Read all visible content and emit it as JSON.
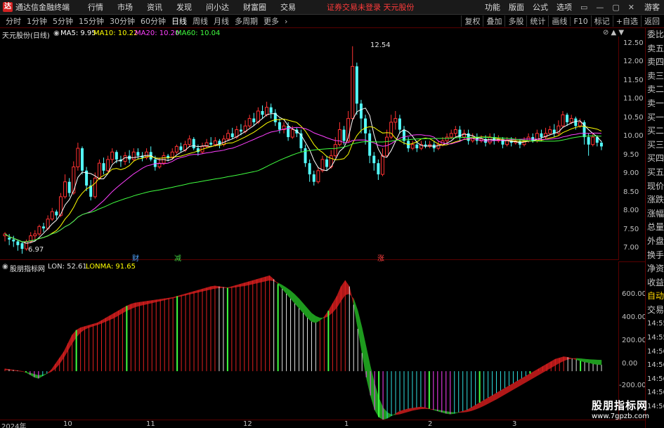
{
  "menubar": {
    "app_name": "通达信金融终端",
    "menus": [
      "行情",
      "市场",
      "资讯",
      "发现",
      "问小达",
      "财富圈",
      "交易"
    ],
    "status": "证券交易未登录  天元股份",
    "right_menus": [
      "功能",
      "版面",
      "公式",
      "选项"
    ],
    "window_controls": [
      "▭",
      "—",
      "▢",
      "✕"
    ],
    "guest": "游客"
  },
  "periodbar": {
    "periods": [
      "分时",
      "1分钟",
      "5分钟",
      "15分钟",
      "30分钟",
      "60分钟",
      "日线",
      "周线",
      "月线",
      "多周期",
      "更多"
    ],
    "active": "日线",
    "tools": [
      "复权",
      "叠加",
      "多股",
      "统计",
      "画线",
      "F10",
      "标记",
      "+自选",
      "返回"
    ]
  },
  "main_chart": {
    "title": "天元股份(日线)",
    "ma": [
      {
        "label": "MA5: 9.95",
        "color": "#ffffff"
      },
      {
        "label": "MA10: 10.22",
        "color": "#ffff00"
      },
      {
        "label": "MA20: 10.20",
        "color": "#ff40ff"
      },
      {
        "label": "MA60: 10.04",
        "color": "#40ff40"
      }
    ],
    "high_label": "12.54",
    "low_label": "6.97",
    "price_axis": [
      "12.50",
      "12.00",
      "11.50",
      "11.00",
      "10.50",
      "10.00",
      "9.50",
      "9.00",
      "8.50",
      "8.00",
      "7.50",
      "7.00"
    ],
    "markers": [
      {
        "text": "财",
        "color": "#4fa3ff"
      },
      {
        "text": "减",
        "color": "#40d040"
      },
      {
        "text": "涨",
        "color": "#ff4040"
      }
    ]
  },
  "indicator": {
    "title": "股朋指标网",
    "lon": "LON: 52.61",
    "lonma": "LONMA: 91.65",
    "axis": [
      "600.00",
      "400.00",
      "200.00",
      "0.00",
      "-200.00"
    ]
  },
  "date_axis": [
    "2024年",
    "10",
    "11",
    "12",
    "1",
    "2",
    "3"
  ],
  "right_panel": {
    "items": [
      "委比",
      "卖五",
      "卖四",
      "卖三",
      "卖二",
      "卖一",
      "买一",
      "买二",
      "买三",
      "买四",
      "买五",
      "现价",
      "涨跌",
      "涨幅",
      "总量",
      "外盘",
      "换手",
      "净资",
      "收益",
      "自动",
      "交易",
      "14:55",
      "14:55",
      "14:56",
      "14:56",
      "14:56",
      "14:56",
      "14:56"
    ],
    "selected": "自动"
  },
  "watermark": {
    "name": "股朋指标网",
    "url": "www.7gpzb.com"
  },
  "chart_data": {
    "type": "candlestick",
    "ylim": [
      6.8,
      12.8
    ],
    "candles": [
      [
        7.45,
        7.5,
        7.3,
        7.55
      ],
      [
        7.4,
        7.35,
        7.2,
        7.5
      ],
      [
        7.35,
        7.3,
        7.15,
        7.45
      ],
      [
        7.3,
        7.2,
        7.05,
        7.35
      ],
      [
        7.25,
        7.1,
        6.97,
        7.3
      ],
      [
        7.1,
        7.3,
        7.05,
        7.35
      ],
      [
        7.3,
        7.45,
        7.25,
        7.55
      ],
      [
        7.45,
        7.5,
        7.35,
        7.6
      ],
      [
        7.5,
        7.7,
        7.45,
        7.75
      ],
      [
        7.7,
        7.65,
        7.55,
        7.8
      ],
      [
        7.65,
        7.9,
        7.6,
        8.0
      ],
      [
        7.9,
        8.1,
        7.85,
        8.2
      ],
      [
        8.1,
        8.0,
        7.9,
        8.15
      ],
      [
        8.0,
        8.5,
        7.95,
        8.6
      ],
      [
        8.5,
        8.9,
        8.45,
        9.1
      ],
      [
        8.9,
        8.6,
        8.5,
        9.0
      ],
      [
        8.6,
        9.3,
        8.55,
        9.45
      ],
      [
        9.3,
        9.8,
        9.2,
        9.95
      ],
      [
        9.8,
        9.2,
        9.1,
        9.85
      ],
      [
        9.2,
        8.8,
        8.65,
        9.3
      ],
      [
        8.8,
        8.5,
        8.4,
        8.95
      ],
      [
        8.5,
        9.0,
        8.45,
        9.15
      ],
      [
        9.0,
        9.4,
        8.95,
        9.5
      ],
      [
        9.4,
        9.2,
        9.1,
        9.55
      ],
      [
        9.2,
        9.5,
        9.15,
        9.6
      ],
      [
        9.5,
        9.7,
        9.4,
        9.8
      ],
      [
        9.7,
        9.5,
        9.4,
        9.75
      ],
      [
        9.5,
        9.45,
        9.3,
        9.6
      ],
      [
        9.45,
        9.6,
        9.35,
        9.7
      ],
      [
        9.6,
        9.5,
        9.4,
        9.75
      ],
      [
        9.5,
        9.7,
        9.45,
        9.8
      ],
      [
        9.7,
        9.6,
        9.5,
        9.8
      ],
      [
        9.6,
        9.55,
        9.45,
        9.7
      ],
      [
        9.55,
        9.7,
        9.5,
        9.8
      ],
      [
        9.7,
        9.5,
        9.45,
        9.85
      ],
      [
        9.5,
        9.3,
        9.2,
        9.6
      ],
      [
        9.3,
        9.4,
        9.25,
        9.55
      ],
      [
        9.4,
        9.6,
        9.35,
        9.7
      ],
      [
        9.6,
        9.55,
        9.45,
        9.65
      ],
      [
        9.55,
        9.7,
        9.5,
        9.8
      ],
      [
        9.7,
        9.85,
        9.65,
        9.9
      ],
      [
        9.85,
        9.75,
        9.7,
        9.95
      ],
      [
        9.75,
        9.9,
        9.7,
        10.0
      ],
      [
        9.9,
        10.05,
        9.85,
        10.15
      ],
      [
        10.05,
        9.8,
        9.75,
        10.1
      ],
      [
        9.8,
        9.7,
        9.6,
        9.9
      ],
      [
        9.7,
        9.85,
        9.65,
        9.95
      ],
      [
        9.85,
        9.95,
        9.8,
        10.05
      ],
      [
        9.95,
        9.9,
        9.85,
        10.1
      ],
      [
        9.9,
        10.0,
        9.85,
        10.1
      ],
      [
        10.0,
        9.9,
        9.8,
        10.05
      ],
      [
        9.9,
        10.05,
        9.85,
        10.15
      ],
      [
        10.05,
        10.2,
        10.0,
        10.3
      ],
      [
        10.2,
        10.1,
        10.05,
        10.35
      ],
      [
        10.1,
        10.3,
        10.05,
        10.4
      ],
      [
        10.3,
        10.25,
        10.15,
        10.45
      ],
      [
        10.25,
        10.4,
        10.2,
        10.55
      ],
      [
        10.4,
        10.6,
        10.35,
        10.7
      ],
      [
        10.6,
        10.5,
        10.4,
        10.75
      ],
      [
        10.5,
        10.8,
        10.45,
        10.9
      ],
      [
        10.8,
        10.7,
        10.6,
        10.95
      ],
      [
        10.7,
        10.9,
        10.65,
        11.05
      ],
      [
        10.9,
        10.75,
        10.6,
        11.0
      ],
      [
        10.75,
        10.5,
        10.4,
        10.85
      ],
      [
        10.5,
        10.3,
        10.2,
        10.6
      ],
      [
        10.3,
        10.4,
        10.2,
        10.5
      ],
      [
        10.4,
        10.1,
        10.0,
        10.5
      ],
      [
        10.1,
        10.3,
        10.05,
        10.4
      ],
      [
        10.3,
        10.2,
        10.1,
        10.35
      ],
      [
        10.2,
        9.8,
        9.7,
        10.3
      ],
      [
        9.8,
        9.4,
        9.3,
        9.9
      ],
      [
        9.4,
        9.1,
        8.9,
        9.5
      ],
      [
        9.1,
        8.9,
        8.8,
        9.2
      ],
      [
        8.9,
        9.2,
        8.85,
        9.3
      ],
      [
        9.2,
        9.5,
        9.15,
        9.6
      ],
      [
        9.5,
        9.3,
        9.2,
        9.6
      ],
      [
        9.3,
        9.6,
        9.25,
        9.75
      ],
      [
        9.6,
        9.9,
        9.55,
        10.1
      ],
      [
        9.9,
        10.3,
        9.85,
        10.5
      ],
      [
        10.3,
        10.0,
        9.9,
        10.4
      ],
      [
        10.0,
        10.6,
        9.95,
        10.8
      ],
      [
        10.6,
        12.0,
        10.55,
        12.54
      ],
      [
        12.0,
        11.0,
        10.7,
        12.1
      ],
      [
        11.0,
        10.6,
        10.2,
        11.1
      ],
      [
        10.6,
        10.2,
        9.9,
        10.7
      ],
      [
        10.2,
        9.6,
        9.4,
        10.3
      ],
      [
        9.6,
        9.4,
        9.2,
        9.7
      ],
      [
        9.4,
        9.1,
        8.95,
        9.5
      ],
      [
        9.1,
        9.6,
        9.05,
        9.8
      ],
      [
        9.6,
        10.1,
        9.55,
        10.3
      ],
      [
        10.1,
        10.5,
        10.05,
        10.7
      ],
      [
        10.5,
        10.6,
        10.3,
        10.8
      ],
      [
        10.6,
        10.3,
        10.2,
        10.7
      ],
      [
        10.3,
        10.0,
        9.9,
        10.4
      ],
      [
        10.0,
        9.8,
        9.7,
        10.1
      ],
      [
        9.8,
        9.9,
        9.75,
        10.0
      ],
      [
        9.9,
        9.8,
        9.7,
        10.0
      ],
      [
        9.8,
        9.9,
        9.75,
        10.0
      ],
      [
        9.9,
        9.85,
        9.8,
        10.0
      ],
      [
        9.85,
        9.9,
        9.8,
        10.0
      ],
      [
        9.9,
        9.8,
        9.7,
        10.0
      ],
      [
        9.8,
        9.9,
        9.75,
        10.0
      ],
      [
        9.9,
        10.0,
        9.85,
        10.1
      ],
      [
        10.0,
        10.1,
        9.95,
        10.2
      ],
      [
        10.1,
        10.2,
        10.05,
        10.3
      ],
      [
        10.2,
        10.3,
        10.1,
        10.4
      ],
      [
        10.3,
        10.1,
        10.0,
        10.4
      ],
      [
        10.1,
        10.2,
        10.05,
        10.3
      ],
      [
        10.2,
        10.0,
        9.9,
        10.3
      ],
      [
        10.0,
        10.1,
        9.95,
        10.2
      ],
      [
        10.1,
        10.0,
        9.9,
        10.2
      ],
      [
        10.0,
        10.05,
        9.95,
        10.15
      ],
      [
        10.05,
        9.95,
        9.85,
        10.15
      ],
      [
        9.95,
        10.1,
        9.9,
        10.2
      ],
      [
        10.1,
        10.0,
        9.9,
        10.2
      ],
      [
        10.0,
        10.05,
        9.95,
        10.15
      ],
      [
        10.05,
        9.9,
        9.8,
        10.1
      ],
      [
        9.9,
        10.0,
        9.85,
        10.1
      ],
      [
        10.0,
        9.95,
        9.85,
        10.1
      ],
      [
        9.95,
        10.0,
        9.9,
        10.1
      ],
      [
        10.0,
        9.9,
        9.8,
        10.05
      ],
      [
        9.9,
        10.0,
        9.85,
        10.1
      ],
      [
        10.0,
        10.1,
        9.95,
        10.2
      ],
      [
        10.1,
        10.0,
        9.95,
        10.2
      ],
      [
        10.0,
        10.2,
        9.95,
        10.3
      ],
      [
        10.2,
        10.1,
        10.0,
        10.3
      ],
      [
        10.1,
        10.2,
        10.05,
        10.35
      ],
      [
        10.2,
        10.3,
        10.15,
        10.4
      ],
      [
        10.3,
        10.2,
        10.1,
        10.45
      ],
      [
        10.2,
        10.4,
        10.15,
        10.55
      ],
      [
        10.4,
        10.7,
        10.35,
        10.8
      ],
      [
        10.7,
        10.5,
        10.4,
        10.75
      ],
      [
        10.5,
        10.6,
        10.45,
        10.7
      ],
      [
        10.6,
        10.4,
        10.3,
        10.65
      ],
      [
        10.4,
        10.5,
        10.35,
        10.6
      ],
      [
        10.5,
        10.1,
        9.9,
        10.55
      ],
      [
        10.1,
        9.9,
        9.6,
        10.2
      ],
      [
        9.9,
        10.1,
        9.85,
        10.2
      ],
      [
        10.1,
        9.95,
        9.85,
        10.15
      ],
      [
        9.95,
        9.85,
        9.75,
        10.0
      ]
    ],
    "lon": [
      20,
      15,
      10,
      5,
      0,
      -10,
      -30,
      -50,
      -60,
      -40,
      -20,
      10,
      60,
      110,
      160,
      230,
      300,
      340,
      360,
      370,
      380,
      390,
      400,
      420,
      440,
      460,
      480,
      500,
      520,
      540,
      555,
      565,
      570,
      575,
      580,
      585,
      590,
      595,
      600,
      605,
      610,
      620,
      630,
      640,
      650,
      660,
      670,
      680,
      690,
      700,
      705,
      700,
      695,
      690,
      700,
      710,
      720,
      730,
      740,
      750,
      760,
      770,
      780,
      790,
      760,
      720,
      680,
      640,
      600,
      560,
      520,
      480,
      440,
      410,
      400,
      420,
      450,
      500,
      560,
      620,
      700,
      750,
      700,
      550,
      350,
      150,
      -50,
      -200,
      -320,
      -380,
      -400,
      -390,
      -370,
      -350,
      -330,
      -320,
      -310,
      -305,
      -300,
      -295,
      -300,
      -310,
      -320,
      -330,
      -340,
      -350,
      -355,
      -350,
      -340,
      -330,
      -320,
      -300,
      -280,
      -260,
      -240,
      -220,
      -200,
      -180,
      -160,
      -140,
      -120,
      -100,
      -80,
      -60,
      -40,
      -20,
      0,
      20,
      40,
      60,
      80,
      100,
      110,
      120,
      115,
      105,
      95,
      85,
      75,
      70,
      60,
      55,
      52.61
    ],
    "lonma": [
      10,
      8,
      5,
      2,
      -2,
      -8,
      -15,
      -25,
      -35,
      -30,
      -20,
      -5,
      20,
      60,
      110,
      170,
      230,
      280,
      320,
      345,
      360,
      372,
      383,
      395,
      410,
      425,
      440,
      460,
      480,
      500,
      515,
      530,
      540,
      548,
      556,
      564,
      572,
      580,
      588,
      596,
      604,
      612,
      620,
      628,
      636,
      644,
      652,
      660,
      668,
      676,
      684,
      688,
      690,
      688,
      690,
      695,
      700,
      705,
      712,
      720,
      728,
      736,
      744,
      752,
      745,
      730,
      712,
      690,
      665,
      635,
      600,
      560,
      520,
      480,
      455,
      440,
      440,
      455,
      485,
      525,
      580,
      630,
      640,
      600,
      500,
      360,
      200,
      40,
      -100,
      -220,
      -300,
      -340,
      -360,
      -360,
      -355,
      -345,
      -335,
      -325,
      -318,
      -312,
      -310,
      -312,
      -316,
      -320,
      -326,
      -332,
      -338,
      -342,
      -342,
      -340,
      -336,
      -328,
      -316,
      -302,
      -286,
      -268,
      -250,
      -232,
      -212,
      -192,
      -172,
      -152,
      -132,
      -112,
      -92,
      -72,
      -52,
      -32,
      -12,
      8,
      28,
      48,
      68,
      85,
      98,
      105,
      106,
      104,
      100,
      97,
      95,
      93,
      91.65
    ],
    "lon_ylim": [
      -400,
      820
    ]
  }
}
